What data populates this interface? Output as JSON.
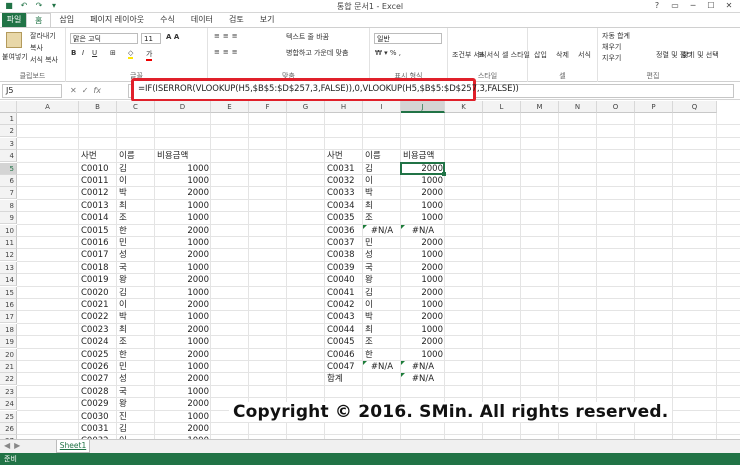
{
  "window": {
    "title": "통합 문서1 - Excel",
    "controls": [
      "?",
      "▭",
      "─",
      "☐",
      "✕"
    ]
  },
  "qat": [
    "save-icon",
    "undo-icon",
    "redo-icon",
    "customize-icon"
  ],
  "tabs": [
    "파일",
    "홈",
    "삽입",
    "페이지 레이아웃",
    "수식",
    "데이터",
    "검토",
    "보기"
  ],
  "active_tab": "홈",
  "ribbon": {
    "clipboard": {
      "paste": "붙여넣기",
      "cut": "잘라내기",
      "copy": "복사",
      "format_painter": "서식 복사",
      "label": "클립보드"
    },
    "font": {
      "name": "맑은 고딕",
      "size": "11",
      "label": "글꼴"
    },
    "alignment": {
      "wrap": "텍스트 줄 바꿈",
      "merge": "병합하고 가운데 맞춤",
      "label": "맞춤"
    },
    "number": {
      "format": "일반",
      "label": "표시 형식"
    },
    "styles": {
      "conditional": "조건부 서식",
      "table": "표 서식",
      "cell": "셀 스타일",
      "label": "스타일"
    },
    "cells": {
      "insert": "삽입",
      "delete": "삭제",
      "format": "서식",
      "label": "셀"
    },
    "editing": {
      "autosum": "자동 합계",
      "fill": "채우기",
      "clear": "지우기",
      "sort": "정렬 및 필터",
      "find": "찾기 및 선택",
      "label": "편집"
    }
  },
  "formula_bar": {
    "name_box": "J5",
    "cancel": "✕",
    "enter": "✓",
    "fx": "fx",
    "formula": "=IF(ISERROR(VLOOKUP(H5,$B$5:$D$257,3,FALSE)),0,VLOOKUP(H5,$B$5:$D$257,3,FALSE))"
  },
  "columns": [
    "A",
    "B",
    "C",
    "D",
    "E",
    "F",
    "G",
    "H",
    "I",
    "J",
    "K",
    "L",
    "M",
    "N",
    "O",
    "P",
    "Q"
  ],
  "rows": [
    "1",
    "2",
    "3",
    "4",
    "5",
    "6",
    "7",
    "8",
    "9",
    "10",
    "11",
    "12",
    "13",
    "14",
    "15",
    "16",
    "17",
    "18",
    "19",
    "20",
    "21",
    "22",
    "23",
    "24",
    "25",
    "26",
    "27"
  ],
  "left_table": {
    "headers": [
      "사번",
      "이름",
      "비용금액"
    ],
    "rows": [
      [
        "C0010",
        "김",
        "1000"
      ],
      [
        "C0011",
        "이",
        "1000"
      ],
      [
        "C0012",
        "박",
        "2000"
      ],
      [
        "C0013",
        "최",
        "1000"
      ],
      [
        "C0014",
        "조",
        "1000"
      ],
      [
        "C0015",
        "한",
        "2000"
      ],
      [
        "C0016",
        "민",
        "1000"
      ],
      [
        "C0017",
        "성",
        "2000"
      ],
      [
        "C0018",
        "국",
        "1000"
      ],
      [
        "C0019",
        "왕",
        "2000"
      ],
      [
        "C0020",
        "김",
        "1000"
      ],
      [
        "C0021",
        "이",
        "2000"
      ],
      [
        "C0022",
        "박",
        "1000"
      ],
      [
        "C0023",
        "최",
        "2000"
      ],
      [
        "C0024",
        "조",
        "1000"
      ],
      [
        "C0025",
        "한",
        "2000"
      ],
      [
        "C0026",
        "민",
        "1000"
      ],
      [
        "C0027",
        "성",
        "2000"
      ],
      [
        "C0028",
        "국",
        "1000"
      ],
      [
        "C0029",
        "왕",
        "2000"
      ],
      [
        "C0030",
        "진",
        "1000"
      ],
      [
        "C0031",
        "김",
        "2000"
      ],
      [
        "C0032",
        "이",
        "1000"
      ]
    ]
  },
  "right_table": {
    "headers": [
      "사번",
      "이름",
      "비용금액"
    ],
    "rows": [
      [
        "C0031",
        "김",
        "2000"
      ],
      [
        "C0032",
        "이",
        "1000"
      ],
      [
        "C0033",
        "박",
        "2000"
      ],
      [
        "C0034",
        "최",
        "1000"
      ],
      [
        "C0035",
        "조",
        "1000"
      ],
      [
        "C0036",
        "#N/A",
        "#N/A"
      ],
      [
        "C0037",
        "민",
        "2000"
      ],
      [
        "C0038",
        "성",
        "1000"
      ],
      [
        "C0039",
        "국",
        "2000"
      ],
      [
        "C0040",
        "왕",
        "1000"
      ],
      [
        "C0041",
        "김",
        "2000"
      ],
      [
        "C0042",
        "이",
        "1000"
      ],
      [
        "C0043",
        "박",
        "2000"
      ],
      [
        "C0044",
        "최",
        "1000"
      ],
      [
        "C0045",
        "조",
        "2000"
      ],
      [
        "C0046",
        "한",
        "1000"
      ],
      [
        "C0047",
        "#N/A",
        "#N/A"
      ]
    ],
    "total_label": "합계",
    "total_value": "#N/A"
  },
  "selected_cell": "J5",
  "watermark": "Copyright © 2016. SMin. All rights reserved.",
  "sheet_tab": "Sheet1",
  "status": "준비",
  "colors": {
    "accent": "#217346",
    "highlight_border": "#e0202a"
  }
}
